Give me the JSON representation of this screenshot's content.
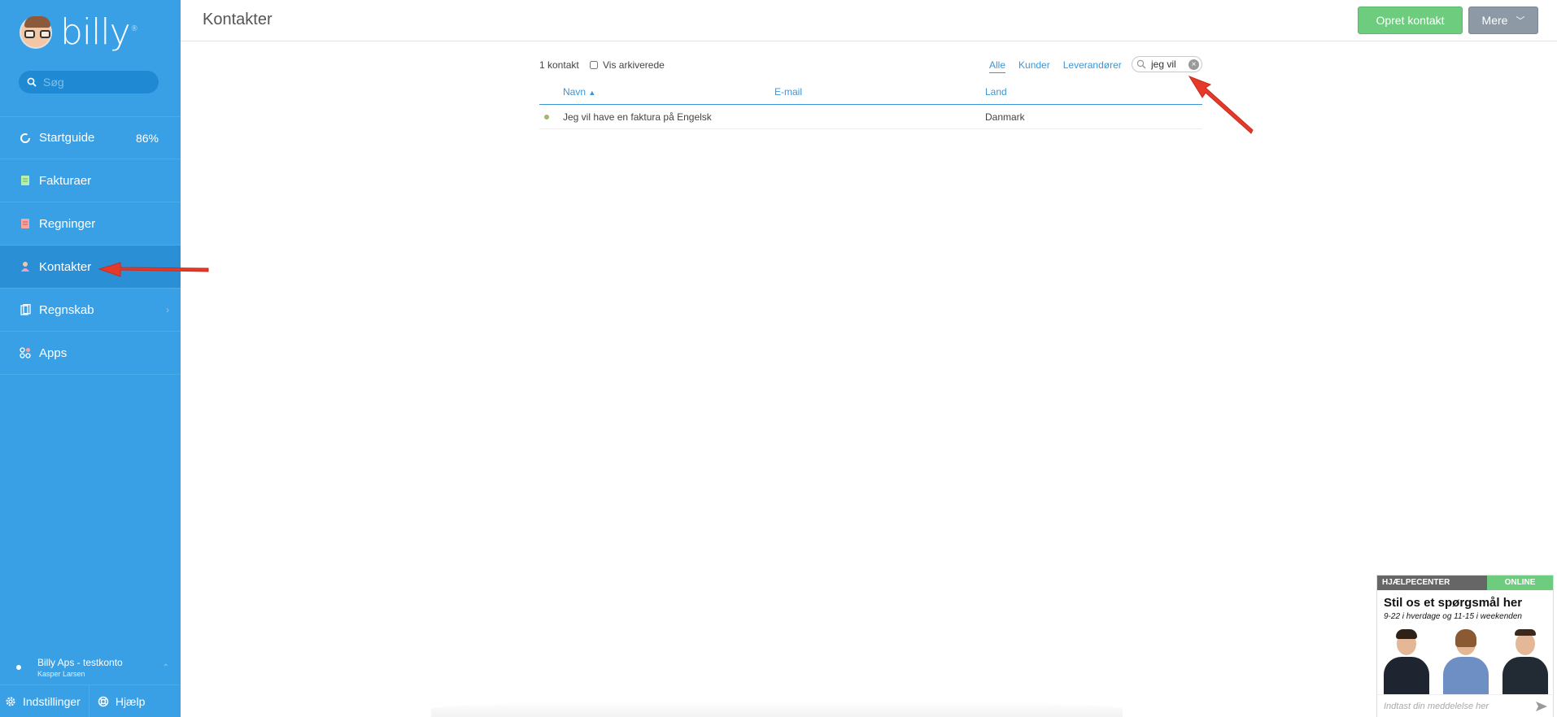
{
  "sidebar": {
    "logo_text": "billy",
    "logo_reg": "®",
    "search_placeholder": "Søg",
    "items": [
      {
        "label": "Startguide",
        "badge": "86%"
      },
      {
        "label": "Fakturaer"
      },
      {
        "label": "Regninger"
      },
      {
        "label": "Kontakter"
      },
      {
        "label": "Regnskab"
      },
      {
        "label": "Apps"
      }
    ],
    "account_name": "Billy Aps - testkonto",
    "account_user": "Kasper Larsen",
    "settings_label": "Indstillinger",
    "help_label": "Hjælp"
  },
  "header": {
    "title": "Kontakter",
    "create_label": "Opret kontakt",
    "more_label": "Mere"
  },
  "toolbar": {
    "count": "1 kontakt",
    "archive_label": "Vis arkiverede",
    "filters": [
      "Alle",
      "Kunder",
      "Leverandører"
    ],
    "active_filter": "Alle",
    "search_value": "jeg vil"
  },
  "table": {
    "columns": [
      "Navn",
      "E-mail",
      "Land"
    ],
    "sort_indicator": "▲",
    "rows": [
      {
        "name": "Jeg vil have en faktura på Engelsk",
        "email": "",
        "country": "Danmark"
      }
    ]
  },
  "help_widget": {
    "header_label": "HJÆLPECENTER",
    "status": "ONLINE",
    "title": "Stil os et spørgsmål her",
    "subtitle": "9-22 i hverdage og 11-15 i weekenden",
    "input_placeholder": "Indtast din meddelelse her"
  },
  "colors": {
    "sidebar": "#3aa0e6",
    "sidebar_active": "#2b8fd5",
    "accent": "#3a96d8",
    "primary_button": "#6dcc7d",
    "secondary_button": "#8d9aa6",
    "annotation_arrow": "#e53a2a"
  },
  "icons": {
    "startguide": "circle-progress-icon",
    "fakturaer": "invoice-icon",
    "regninger": "bill-icon",
    "kontakter": "person-icon",
    "regnskab": "books-icon",
    "apps": "apps-icon"
  }
}
